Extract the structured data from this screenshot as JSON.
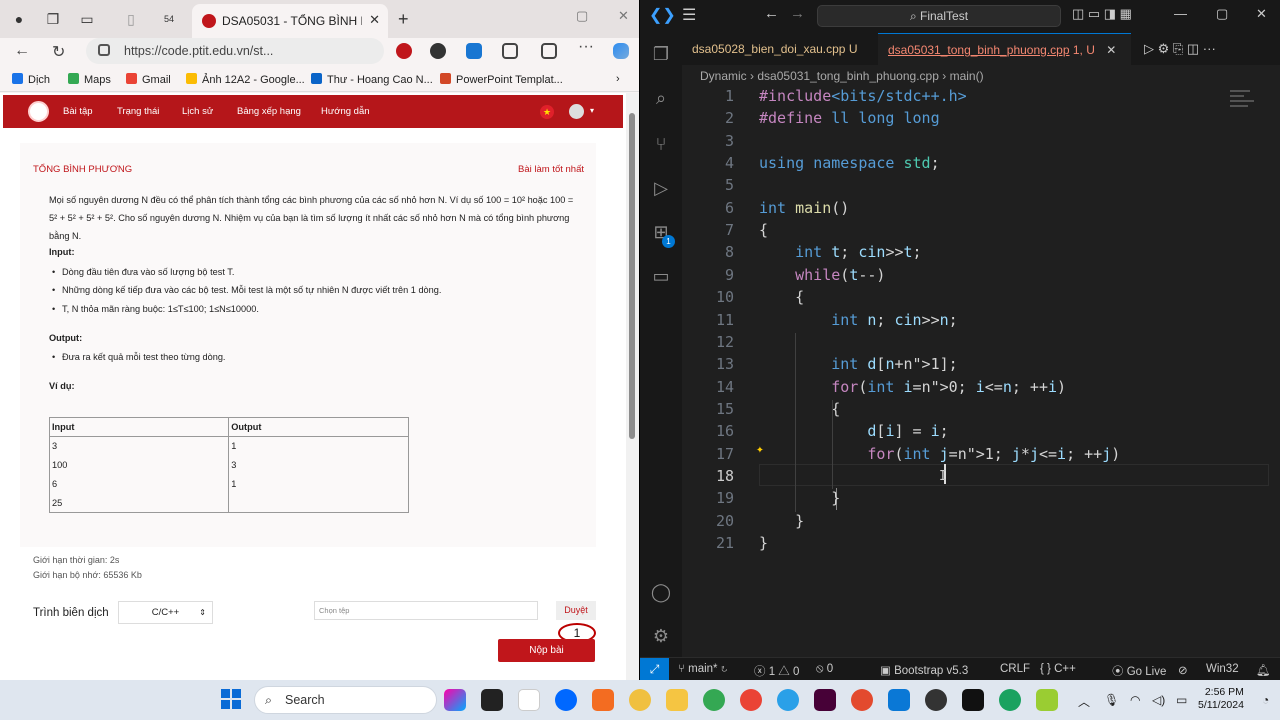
{
  "browser": {
    "tab_count": "54",
    "active_tab_title": "DSA05031 - TỔNG BÌNH PHƯƠNG",
    "url": "https://code.ptit.edu.vn/st...",
    "bookmarks": [
      "Dịch",
      "Maps",
      "Gmail",
      "Ảnh 12A2 - Google...",
      "Thư - Hoang Cao N...",
      "PowerPoint Templat..."
    ]
  },
  "site": {
    "menu": [
      "Bài tập",
      "Trạng thái",
      "Lịch sử",
      "Bảng xếp hạng",
      "Hướng dẫn"
    ],
    "problem_title": "TỔNG BÌNH PHƯƠNG",
    "best_label": "Bài làm tốt nhất",
    "statement_line1": "Mọi số nguyên dương N đều có thể phân tích thành tổng các bình phương của các số nhỏ hơn N. Ví dụ số 100 = 10² hoặc 100 =",
    "statement_line2": "5² + 5² + 5² + 5². Cho số nguyên dương N. Nhiệm vụ của bạn là tìm số lượng ít nhất các số nhỏ hơn N mà có tổng bình phương",
    "statement_line3": "bằng N.",
    "input_heading": "Input:",
    "input_items": [
      "Dòng đầu tiên đưa vào số lượng bộ test T.",
      "Những dòng kế tiếp đưa vào các bộ test. Mỗi test là một số tự nhiên N được viết trên 1 dòng.",
      "T, N thỏa mãn ràng buộc: 1≤T≤100;  1≤N≤10000."
    ],
    "output_heading": "Output:",
    "output_items": [
      "Đưa ra kết quả mỗi test theo từng dòng."
    ],
    "example_heading": "Ví dụ:",
    "table_headers": [
      "Input",
      "Output"
    ],
    "table_rows": [
      [
        "3",
        "1"
      ],
      [
        "100",
        "3"
      ],
      [
        "6",
        "1"
      ],
      [
        "25",
        ""
      ]
    ],
    "time_limit": "Giới hạn thời gian: 2s",
    "memory_limit": "Giới hạn bộ nhớ: 65536 Kb",
    "compiler_label": "Trình biên dịch",
    "compiler_value": "C/C++",
    "file_placeholder": "Chọn tệp",
    "browse_label": "Duyệt",
    "submit_label": "Nộp bài",
    "annotation_number": "1"
  },
  "vscode": {
    "search": "FinalTest",
    "tabs": [
      {
        "name": "dsa05028_bien_doi_xau.cpp",
        "status": "U"
      },
      {
        "name": "dsa05031_tong_binh_phuong.cpp",
        "status": "1, U"
      }
    ],
    "breadcrumb": [
      "Dynamic",
      "dsa05031_tong_binh_phuong.cpp",
      "main()"
    ],
    "explorer_badge": "1",
    "current_line": "18",
    "code_lines": [
      "#include<bits/stdc++.h>",
      "#define ll long long",
      "",
      "using namespace std;",
      "",
      "int main()",
      "{",
      "    int t; cin>>t;",
      "    while(t--)",
      "    {",
      "        int n; cin>>n;",
      "",
      "        int d[n+1];",
      "        for(int i=0; i<=n; ++i)",
      "        {",
      "            d[i] = i;",
      "            for(int j=1; j*j<=i; ++j)",
      "                ",
      "        }",
      "    }",
      "}"
    ],
    "status": {
      "branch": "main*",
      "errors": "1",
      "warnings": "0",
      "ports": "0",
      "bootstrap": "Bootstrap v5.3",
      "eol": "CRLF",
      "lang": "C++",
      "live": "Go Live",
      "platform": "Win32"
    }
  },
  "taskbar": {
    "search": "Search",
    "time": "2:56 PM",
    "date": "5/11/2024"
  },
  "colors": {
    "ptit_red": "#b5161a",
    "vscode_bg": "#1f1f1f",
    "vscode_blue": "#0078d4"
  }
}
